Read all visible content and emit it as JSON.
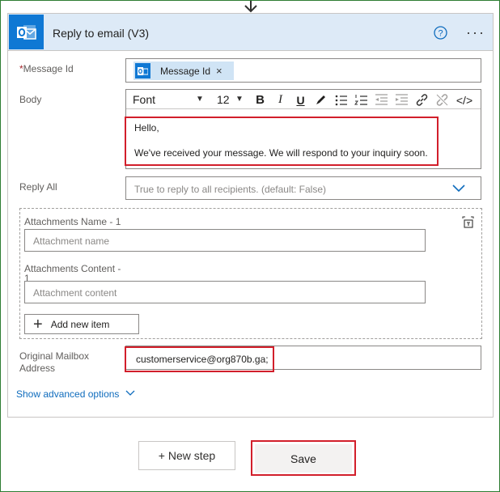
{
  "card": {
    "title": "Reply to email (V3)",
    "icons": {
      "app": "outlook-icon",
      "help": "help-circle-icon",
      "more": "more-options-icon"
    },
    "accent_color": "#0f78d4",
    "header_bg": "#ddeaf7"
  },
  "fields": {
    "message_id": {
      "label": "Message Id",
      "required_mark": "*",
      "token": "Message Id",
      "token_remove": "×"
    },
    "body": {
      "label": "Body",
      "toolbar": {
        "font": "Font",
        "size": "12",
        "bold": "B",
        "italic": "I",
        "underline": "U",
        "source_code": "</>"
      },
      "lines": [
        "Hello,",
        "We've received your message. We will respond to your inquiry soon."
      ]
    },
    "reply_all": {
      "label": "Reply All",
      "placeholder": "True to reply to all recipients. (default: False)"
    },
    "attachments": {
      "name_label": "Attachments Name - 1",
      "name_placeholder": "Attachment name",
      "content_label_line1": "Attachments Content -",
      "content_label_line2": "1",
      "content_placeholder": "Attachment content",
      "add_button": "Add new item"
    },
    "mailbox": {
      "label_line1": "Original Mailbox",
      "label_line2": "Address",
      "value": "customerservice@org870b.ga;"
    }
  },
  "advanced": {
    "link": "Show advanced options"
  },
  "footer": {
    "new_step": "+ New step",
    "save": "Save"
  },
  "highlight_color": "#d21f2b"
}
